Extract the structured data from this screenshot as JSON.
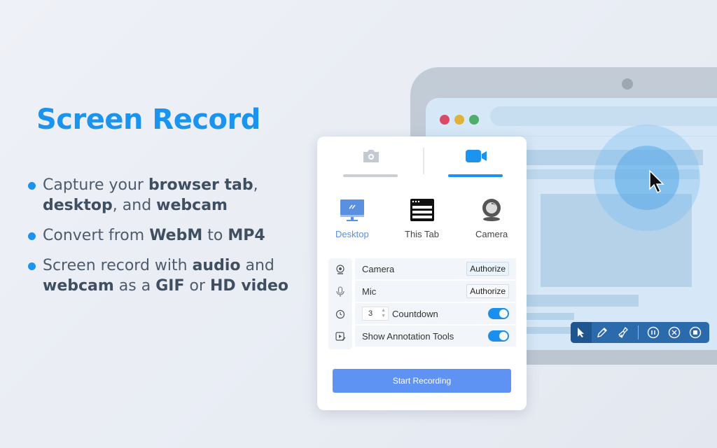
{
  "hero": {
    "title": "Screen Record",
    "bullets": [
      {
        "parts": [
          {
            "t": "Capture your ",
            "b": false
          },
          {
            "t": "browser tab",
            "b": true
          },
          {
            "t": ", ",
            "b": false
          },
          {
            "t": "desktop",
            "b": true
          },
          {
            "t": ", and ",
            "b": false
          },
          {
            "t": "webcam",
            "b": true
          }
        ]
      },
      {
        "parts": [
          {
            "t": "Convert from ",
            "b": false
          },
          {
            "t": "WebM",
            "b": true
          },
          {
            "t": " to ",
            "b": false
          },
          {
            "t": "MP4",
            "b": true
          }
        ]
      },
      {
        "parts": [
          {
            "t": "Screen record with ",
            "b": false
          },
          {
            "t": "audio",
            "b": true
          },
          {
            "t": " and ",
            "b": false
          },
          {
            "t": "webcam",
            "b": true
          },
          {
            "t": " as a ",
            "b": false
          },
          {
            "t": "GIF",
            "b": true
          },
          {
            "t": " or ",
            "b": false
          },
          {
            "t": "HD video",
            "b": true
          }
        ]
      }
    ]
  },
  "popup": {
    "mode_tabs": [
      {
        "name": "screenshot",
        "icon": "camera-icon",
        "active": false
      },
      {
        "name": "video",
        "icon": "video-camera-icon",
        "active": true
      }
    ],
    "sources": [
      {
        "label": "Desktop",
        "icon": "monitor-icon",
        "active": true
      },
      {
        "label": "This Tab",
        "icon": "browser-tab-icon",
        "active": false
      },
      {
        "label": "Camera",
        "icon": "webcam-icon",
        "active": false
      }
    ],
    "settings": {
      "camera_label": "Camera",
      "camera_button": "Authorize",
      "mic_label": "Mic",
      "mic_button": "Authorize",
      "countdown_value": "3",
      "countdown_label": "Countdown",
      "countdown_enabled": true,
      "annotation_label": "Show Annotation Tools",
      "annotation_enabled": true
    },
    "start_button": "Start Recording"
  },
  "annotation_toolbar": {
    "tools": [
      "cursor-icon",
      "pencil-icon",
      "brush-icon"
    ],
    "controls": [
      "pause-icon",
      "cancel-icon",
      "stop-icon"
    ]
  },
  "colors": {
    "accent": "#1a94ee",
    "button": "#5e92f3",
    "toolbar": "#2b6aab",
    "traffic_red": "#d94a66",
    "traffic_yellow": "#e0b23a",
    "traffic_green": "#4fae6a"
  }
}
